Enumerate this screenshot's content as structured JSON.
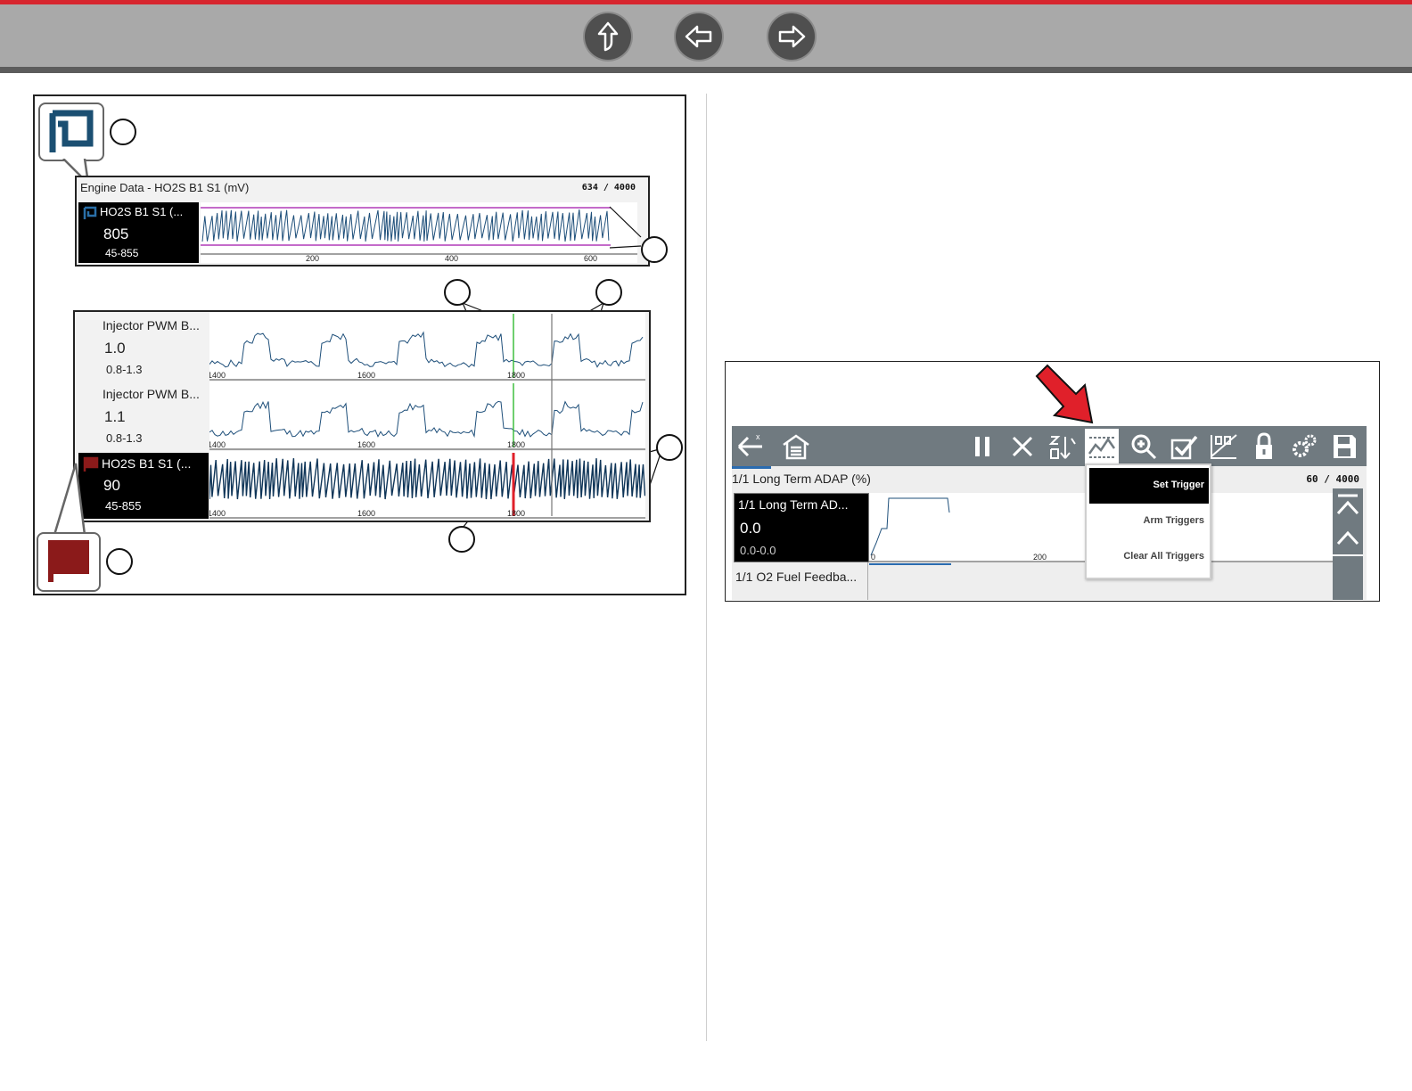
{
  "nav": {
    "up_label": "Up",
    "back_label": "Back",
    "forward_label": "Forward"
  },
  "figure_left": {
    "top_panel": {
      "title": "Engine Data - HO2S B1 S1 (mV)",
      "count": "634 / 4000",
      "pid_label": "HO2S B1 S1 (...",
      "pid_value": "805",
      "pid_range": "45-855",
      "x_ticks": [
        "200",
        "400",
        "600"
      ]
    },
    "bottom_panel": {
      "rows": [
        {
          "label": "Injector PWM B...",
          "value": "1.0",
          "range": "0.8-1.3",
          "ticks": [
            "1400",
            "1600",
            "1800"
          ]
        },
        {
          "label": "Injector PWM B...",
          "value": "1.1",
          "range": "0.8-1.3",
          "ticks": [
            "1400",
            "1600",
            "1800"
          ]
        },
        {
          "label": "HO2S B1 S1 (...",
          "value": "90",
          "range": "45-855",
          "ticks": [
            "1400",
            "1600",
            "1800"
          ]
        }
      ]
    },
    "colors": {
      "flag_blue": "#1b4f72",
      "flag_red": "#8b1a1a",
      "limit_magenta": "#b03ab8",
      "cursor_green": "#3fbf3f",
      "cursor_red": "#e0202a"
    }
  },
  "figure_right": {
    "toolbar_icons": [
      "back-arrow-icon",
      "home-icon",
      "pause-icon",
      "clear-icon",
      "sort-icon",
      "trigger-icon",
      "zoom-icon",
      "check-icon",
      "graph-icon",
      "lock-icon",
      "settings-icon",
      "save-icon"
    ],
    "panel_title": "1/1 Long Term ADAP (%)",
    "count": "60 / 4000",
    "pid1_label": "1/1 Long Term AD...",
    "pid1_value": "0.0",
    "pid1_range": "0.0-0.0",
    "pid2_label": "1/1 O2 Fuel Feedba...",
    "x_ticks": [
      "0",
      "200"
    ],
    "menu": {
      "set_trigger": "Set Trigger",
      "arm_triggers": "Arm Triggers",
      "clear_all_triggers": "Clear All Triggers"
    }
  }
}
